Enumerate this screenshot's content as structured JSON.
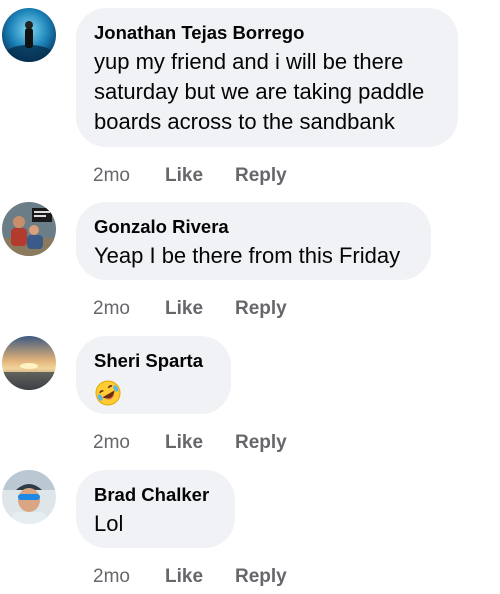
{
  "comments": [
    {
      "author": "Jonathan Tejas Borrego",
      "text": "yup my friend and i will be there saturday but we are taking paddle boards across to the sandbank",
      "time": "2mo",
      "like_label": "Like",
      "reply_label": "Reply"
    },
    {
      "author": "Gonzalo Rivera",
      "text": "Yeap I be there from this Friday",
      "time": "2mo",
      "like_label": "Like",
      "reply_label": "Reply"
    },
    {
      "author": "Sheri Sparta",
      "text": "",
      "emoji": "rolling-on-floor-laughing-emoji",
      "time": "2mo",
      "like_label": "Like",
      "reply_label": "Reply"
    },
    {
      "author": "Brad Chalker",
      "text": "Lol",
      "time": "2mo",
      "like_label": "Like",
      "reply_label": "Reply"
    }
  ],
  "colors": {
    "bubble_bg": "#f0f2f5",
    "text": "#050505",
    "meta": "#65676b"
  }
}
